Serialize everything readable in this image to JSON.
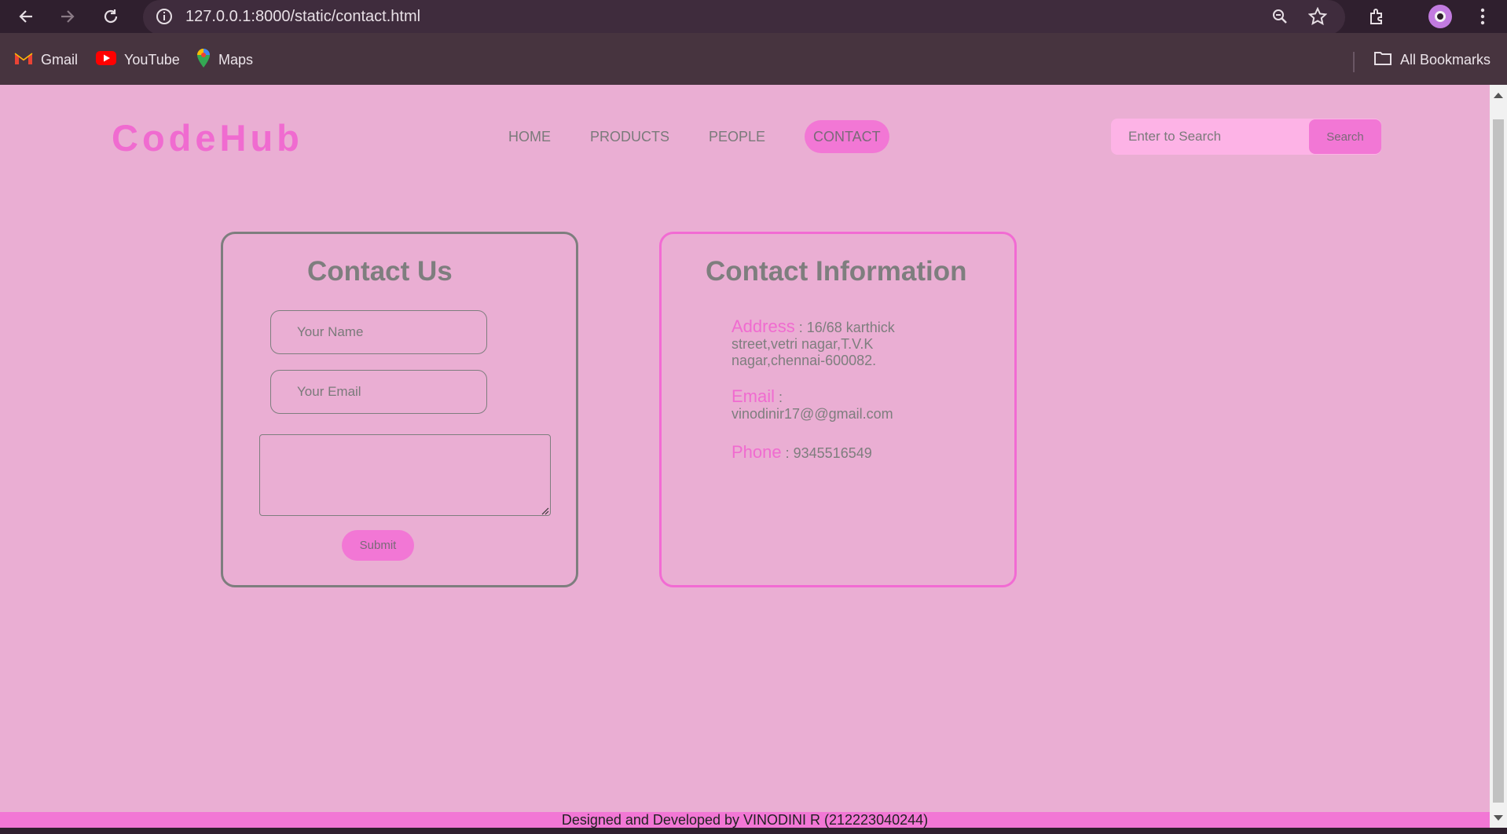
{
  "browser": {
    "url": "127.0.0.1:8000/static/contact.html",
    "bookmarks": [
      {
        "label": "Gmail",
        "icon": "gmail-icon"
      },
      {
        "label": "YouTube",
        "icon": "youtube-icon"
      },
      {
        "label": "Maps",
        "icon": "maps-icon"
      }
    ],
    "all_bookmarks": "All Bookmarks"
  },
  "header": {
    "logo": "CodeHub",
    "nav": [
      "HOME",
      "PRODUCTS",
      "PEOPLE",
      "CONTACT"
    ],
    "active_nav": "CONTACT",
    "search_placeholder": "Enter to Search",
    "search_button": "Search"
  },
  "contact_form": {
    "title": "Contact Us",
    "name_placeholder": "Your Name",
    "email_placeholder": "Your Email",
    "message_value": "",
    "submit_label": "Submit"
  },
  "contact_info": {
    "title": "Contact Information",
    "address_label": "Address",
    "address_value": " : 16/68 karthick street,vetri nagar,T.V.K nagar,chennai-600082.",
    "email_label": "Email",
    "email_value": " : vinodinir17@@gmail.com",
    "phone_label": "Phone",
    "phone_value": " : 9345516549"
  },
  "footer": {
    "text": "Designed and Developed by VINODINI R (212223040244)"
  },
  "colors": {
    "page_background": "#eaaed3",
    "accent_pink": "#f277d5",
    "logo_pink": "#f06bd0",
    "text_gray": "#7e7e7e",
    "chrome_dark": "#2f1f2e"
  }
}
